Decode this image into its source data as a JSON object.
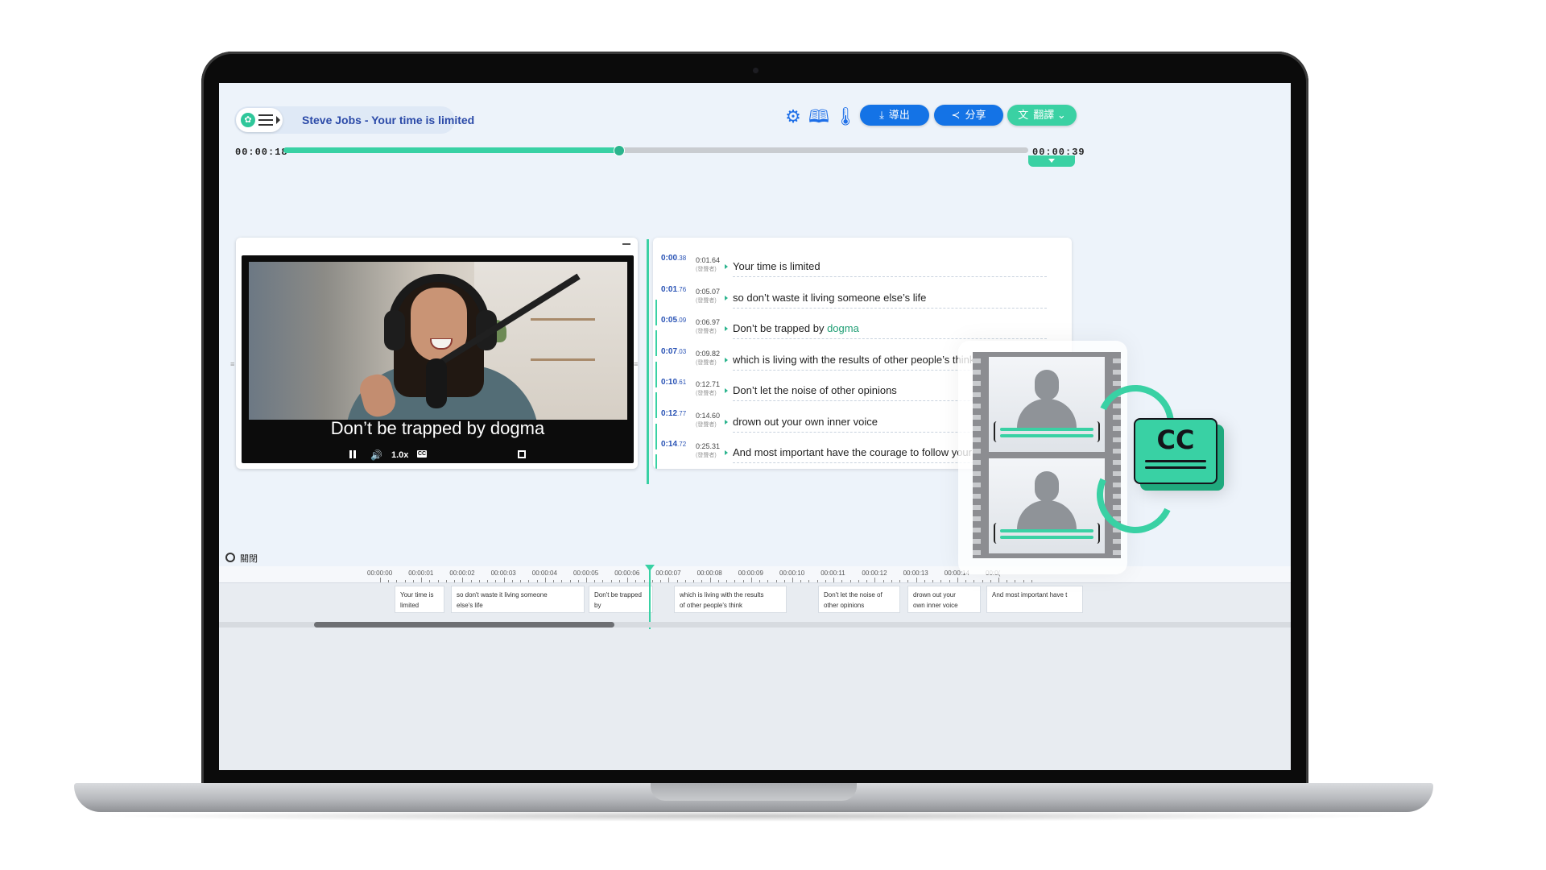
{
  "app": {
    "title": "Steve Jobs - Your time is limited"
  },
  "toolbar": {
    "icons": [
      "gear-icon",
      "book-icon",
      "thermometer-icon"
    ],
    "export_label": "導出",
    "share_label": "分享",
    "translate_label": "翻譯"
  },
  "player": {
    "current_time": "00:00:18",
    "total_time": "00:00:39",
    "progress_fraction": 0.45,
    "caption": "Don’t be trapped by dogma",
    "speed": "1.0x"
  },
  "transcript": [
    {
      "start": "0:00",
      "start_frac": ".38",
      "end": "0:01.64",
      "speaker": "(發聲者)",
      "text": "Your time is limited",
      "keyword": ""
    },
    {
      "start": "0:01",
      "start_frac": ".76",
      "end": "0:05.07",
      "speaker": "(發聲者)",
      "text": "so don’t waste it living someone else’s life",
      "keyword": ""
    },
    {
      "start": "0:05",
      "start_frac": ".09",
      "end": "0:06.97",
      "speaker": "(發聲者)",
      "text": "Don’t be trapped by ",
      "keyword": "dogma"
    },
    {
      "start": "0:07",
      "start_frac": ".03",
      "end": "0:09.82",
      "speaker": "(發聲者)",
      "text": "which is living with the results of other people’s think",
      "keyword": ""
    },
    {
      "start": "0:10",
      "start_frac": ".61",
      "end": "0:12.71",
      "speaker": "(發聲者)",
      "text": "Don’t let the noise of other opinions",
      "keyword": ""
    },
    {
      "start": "0:12",
      "start_frac": ".77",
      "end": "0:14.60",
      "speaker": "(發聲者)",
      "text": "drown out your own inner voice",
      "keyword": ""
    },
    {
      "start": "0:14",
      "start_frac": ".72",
      "end": "0:25.31",
      "speaker": "(發聲者)",
      "text": "And most important have the courage to follow your heart and",
      "keyword": ""
    }
  ],
  "timeline": {
    "toggle_label": "關閉",
    "ticks": [
      "00:00:00",
      "00:00:01",
      "00:00:02",
      "00:00:03",
      "00:00:04",
      "00:00:05",
      "00:00:06",
      "00:00:07",
      "00:00:08",
      "00:00:09",
      "00:00:10",
      "00:00:11",
      "00:00:12",
      "00:00:13",
      "00:00:14",
      "00:0("
    ],
    "cues": [
      {
        "line1": "Your time is",
        "line2": "limited"
      },
      {
        "line1": "so don't waste it living someone",
        "line2": "else's life"
      },
      {
        "line1": "Don't be trapped by",
        "line2": "dogma"
      },
      {
        "line1": "which is living with the results",
        "line2": "of other people's think"
      },
      {
        "line1": "Don't let the noise of",
        "line2": "other opinions"
      },
      {
        "line1": "drown out your",
        "line2": "own inner voice"
      },
      {
        "line1": "And most important have t",
        "line2": ""
      }
    ]
  },
  "illustration": {
    "cc_label": "CC"
  },
  "colors": {
    "accent_green": "#39d1a4",
    "primary_blue": "#1473e6",
    "title_blue": "#2b4aa8"
  }
}
